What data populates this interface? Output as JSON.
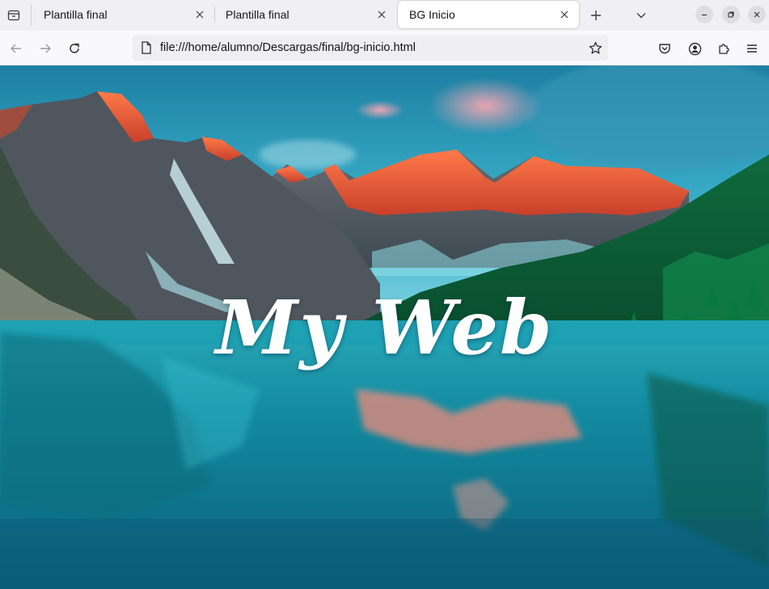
{
  "browser": {
    "tabs": [
      {
        "title": "Plantilla final",
        "active": false
      },
      {
        "title": "Plantilla final",
        "active": false
      },
      {
        "title": "BG Inicio",
        "active": true
      }
    ],
    "url": "file:///home/alumno/Descargas/final/bg-inicio.html",
    "icons": {
      "tab_list": "tab-list-icon",
      "new_tab": "plus-icon",
      "tab_overflow": "chevron-down-icon",
      "back": "arrow-left-icon",
      "forward": "arrow-right-icon",
      "reload": "reload-icon",
      "page": "page-icon",
      "bookmark": "star-icon",
      "pocket": "pocket-icon",
      "account": "account-icon",
      "extensions": "puzzle-icon",
      "menu": "hamburger-icon"
    }
  },
  "page": {
    "hero_title": "My Web",
    "colors": {
      "title_text": "#ffffff",
      "sky": "#2aa6c4",
      "lake": "#1b8fa6",
      "peaks_glow": "#f0603a",
      "forest": "#0f5a36"
    }
  }
}
